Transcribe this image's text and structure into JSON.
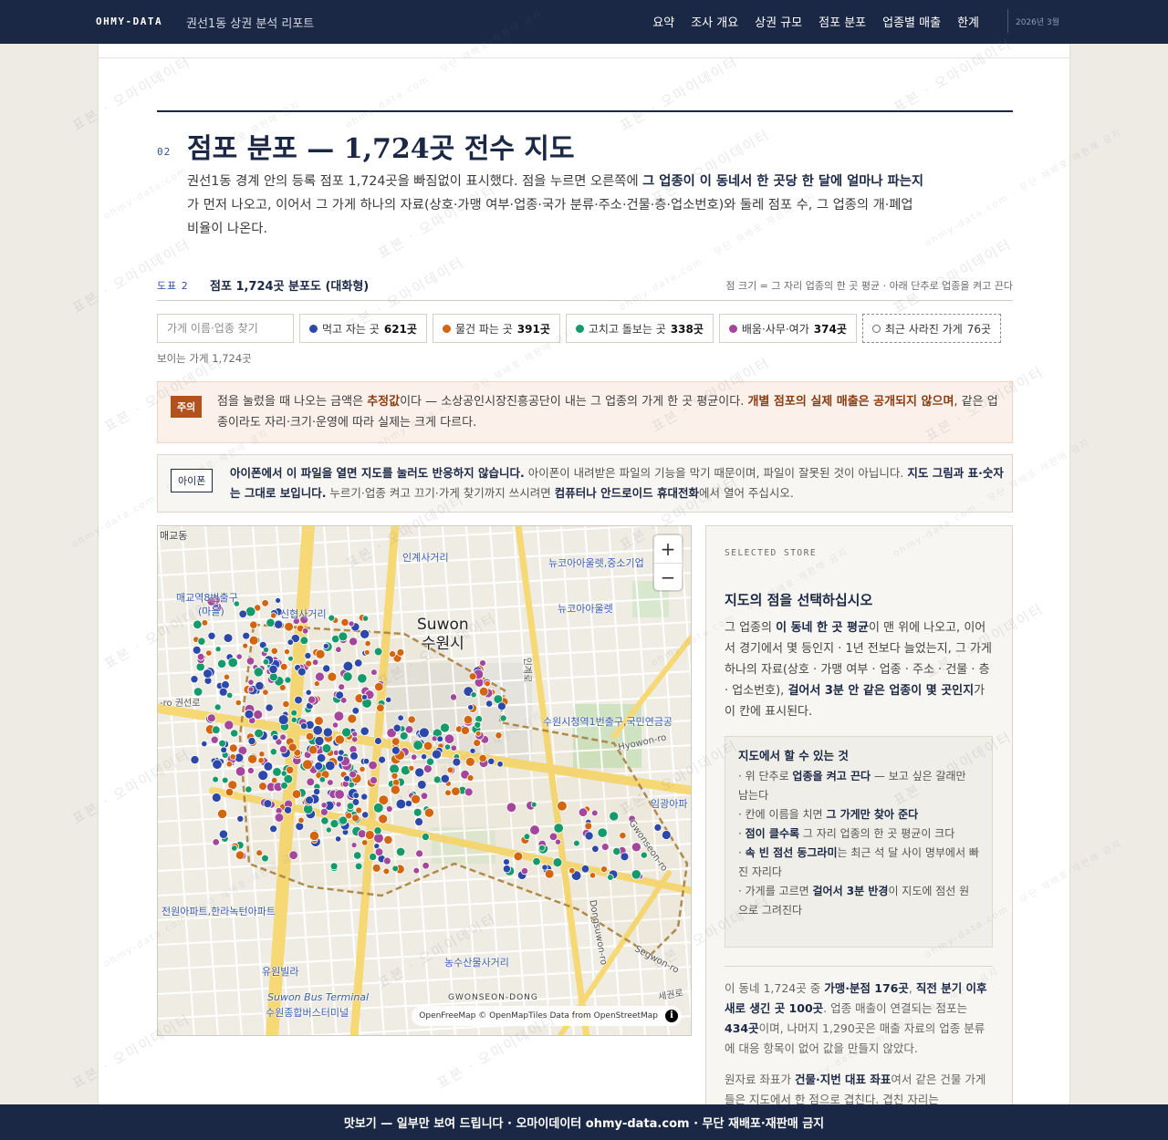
{
  "header": {
    "brand": "OHMY-DATA",
    "report_title": "권선1동 상권 분석 리포트",
    "nav": [
      "요약",
      "조사 개요",
      "상권 규모",
      "점포 분포",
      "업종별 매출",
      "한계"
    ],
    "date": "2026년 3월"
  },
  "section": {
    "number": "02",
    "title": "점포 분포 — 1,724곳 전수 지도",
    "lead_1": "권선1동 경계 안의 등록 점포 1,724곳을 빠짐없이 표시했다. 점을 누르면 오른쪽에 ",
    "lead_bold": "그 업종이 이 동네서 한 곳당 한 달에 얼마나 파는지",
    "lead_2": "가 먼저 나오고, 이어서 그 가게 하나의 자료(상호·가맹 여부·업종·국가 분류·주소·건물·층·업소번호)와 둘레 점포 수, 그 업종의 개·폐업 비율이 나온다."
  },
  "figure": {
    "number": "도표 2",
    "title": "점포 1,724곳 분포도 (대화형)",
    "note": "점 크기 = 그 자리 업종의 한 곳 평균 · 아래 단추로 업종을 켜고 끈다"
  },
  "controls": {
    "search_placeholder": "가게 이름·업종 찾기",
    "visible_count": "보이는 가게 1,724곳",
    "chips": [
      {
        "label": "먹고 자는 곳",
        "count": "621곳",
        "color": "#2c48a8"
      },
      {
        "label": "물건 파는 곳",
        "count": "391곳",
        "color": "#d4650f"
      },
      {
        "label": "고치고 돌보는 곳",
        "count": "338곳",
        "color": "#159a6b"
      },
      {
        "label": "배움·사무·여가",
        "count": "374곳",
        "color": "#a4479c"
      }
    ],
    "closed_chip": {
      "label": "최근 사라진 가게",
      "count": "76곳"
    }
  },
  "warning": {
    "tag": "주의",
    "text_1": "점을 눌렀을 때 나오는 금액은 ",
    "bold_1": "추정값",
    "text_2": "이다 — 소상공인시장진흥공단이 내는 그 업종의 가게 한 곳 평균이다. ",
    "bold_2": "개별 점포의 실제 매출은 공개되지 않으며",
    "text_3": ", 같은 업종이라도 자리·크기·운영에 따라 실제는 크게 다르다."
  },
  "ios_notice": {
    "tag": "아이폰",
    "bold_1": "아이폰에서 이 파일을 열면 지도를 눌러도 반응하지 않습니다.",
    "text_1": " 아이폰이 내려받은 파일의 기능을 막기 때문이며, 파일이 잘못된 것이 아닙니다. ",
    "bold_2": "지도 그림과 표·숫자는 그대로 보입니다.",
    "text_2": " 누르기·업종 켜고 끄기·가게 찾기까지 쓰시려면 ",
    "bold_3": "컴퓨터나 안드로이드 휴대전화",
    "text_3": "에서 열어 주십시오."
  },
  "map": {
    "zoom_in": "+",
    "zoom_out": "−",
    "attribution": "OpenFreeMap © OpenMapTiles Data from OpenStreetMap",
    "labels": {
      "city_en": "Suwon",
      "city_ko": "수원시",
      "l1": "인계사거리",
      "l2": "뉴코아아울렛,중소기업",
      "l3": "뉴코아아울렛",
      "l4": "매교역8번출구",
      "l5": "(마을)",
      "l6": "신협사거리",
      "l7": "수원시청역1번출구,국민연금공",
      "l8": "임광아파",
      "l9": "전원아파트,한라녹턴아파트",
      "l10": "농수산물사거리",
      "l11": "유원빌라",
      "l12": "Suwon Bus Terminal",
      "l13": "수원종합버스터미널",
      "l14": "GWONSEON-DONG",
      "l15": "매교동",
      "r1": "Hyowon-ro",
      "r2": "Gwonseon-ro",
      "r3": "Dongsuwon-ro",
      "r4": "Segwon-ro",
      "r5": "-ro 권선로",
      "r6": "인계로",
      "r7": "세권로"
    }
  },
  "panel": {
    "eyebrow": "SELECTED STORE",
    "title": "지도의 점을 선택하십시오",
    "d1": "그 업종의 ",
    "d1b": "이 동네 한 곳 평균",
    "d2": "이 맨 위에 나오고, 이어서 경기에서 몇 등인지 · 1년 전보다 늘었는지, 그 가게 하나의 자료(상호 · 가맹 여부 · 업종 · 주소 · 건물 · 층 · 업소번호), ",
    "d2b": "걸어서 3분 안 같은 업종이 몇 곳인지",
    "d3": "가 이 칸에 표시된다.",
    "howto_title": "지도에서 할 수 있는 것",
    "howto": [
      {
        "pre": "· 위 단추로 ",
        "b": "업종을 켜고 끈다",
        "post": " — 보고 싶은 갈래만 남는다"
      },
      {
        "pre": "· 칸에 이름을 치면 ",
        "b": "그 가게만 찾아 준다",
        "post": ""
      },
      {
        "pre": "· ",
        "b": "점이 클수록",
        "post": " 그 자리 업종의 한 곳 평균이 크다"
      },
      {
        "pre": "· ",
        "b": "속 빈 점선 동그라미",
        "post": "는 최근 석 달 사이 명부에서 빠진 자리다"
      },
      {
        "pre": "· 가게를 고르면 ",
        "b": "걸어서 3분 반경",
        "post": "이 지도에 점선 원으로 그려진다"
      }
    ],
    "s1": "이 동네 1,724곳 중 ",
    "s1b": "가맹·분점 176곳",
    "s2": ", ",
    "s2b": "직전 분기 이후 새로 생긴 곳 100곳",
    "s3": ". 업종 매출이 연결되는 점포는 ",
    "s3b": "434곳",
    "s4": "이며, 나머지 1,290곳은 매출 자료의 업종 분류에 대응 항목이 없어 값을 만들지 않았다.",
    "n1": "원자료 좌표가 ",
    "n1b": "건물·지번 대표 좌표",
    "n2": "여서 같은 건물 가게들은 지도에서 한 점으로 겹친다. 겹친 자리는"
  },
  "watermark": {
    "text": "표본 · 오마이데이터",
    "small": "ohmy-data.com · 무단 재배포·재판매 금지"
  },
  "footer": {
    "text": "맛보기 — 일부만 보여 드립니다 · 오마이데이터 ohmy-data.com · 무단 재배포·재판매 금지"
  }
}
